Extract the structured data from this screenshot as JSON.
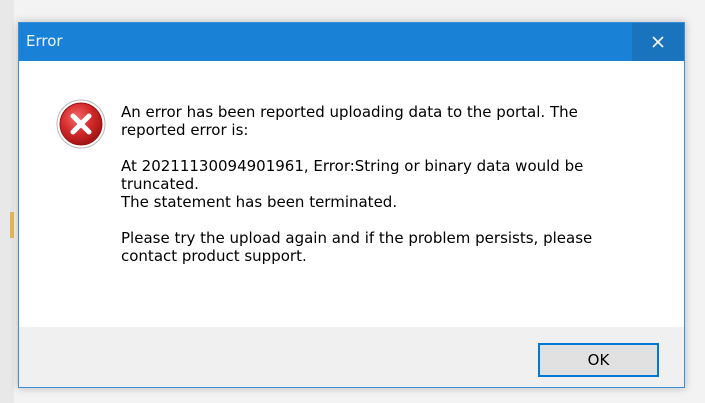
{
  "window": {
    "title": "Error",
    "close_glyph": "✕"
  },
  "message": {
    "line1": "An error has been reported uploading data to the portal.  The",
    "line2": "reported error is:",
    "line3": "At 20211130094901961, Error:String or binary data would be",
    "line4": "truncated.",
    "line5": "The statement has been terminated.",
    "line6": "Please try the upload again and if the problem persists, please",
    "line7": "contact product support."
  },
  "buttons": {
    "ok_label": "OK"
  },
  "icons": {
    "error": "error-x-icon",
    "close": "close-icon"
  },
  "colors": {
    "titlebar": "#1a82d6",
    "accent": "#0078d7",
    "error_red": "#d52b2b"
  }
}
